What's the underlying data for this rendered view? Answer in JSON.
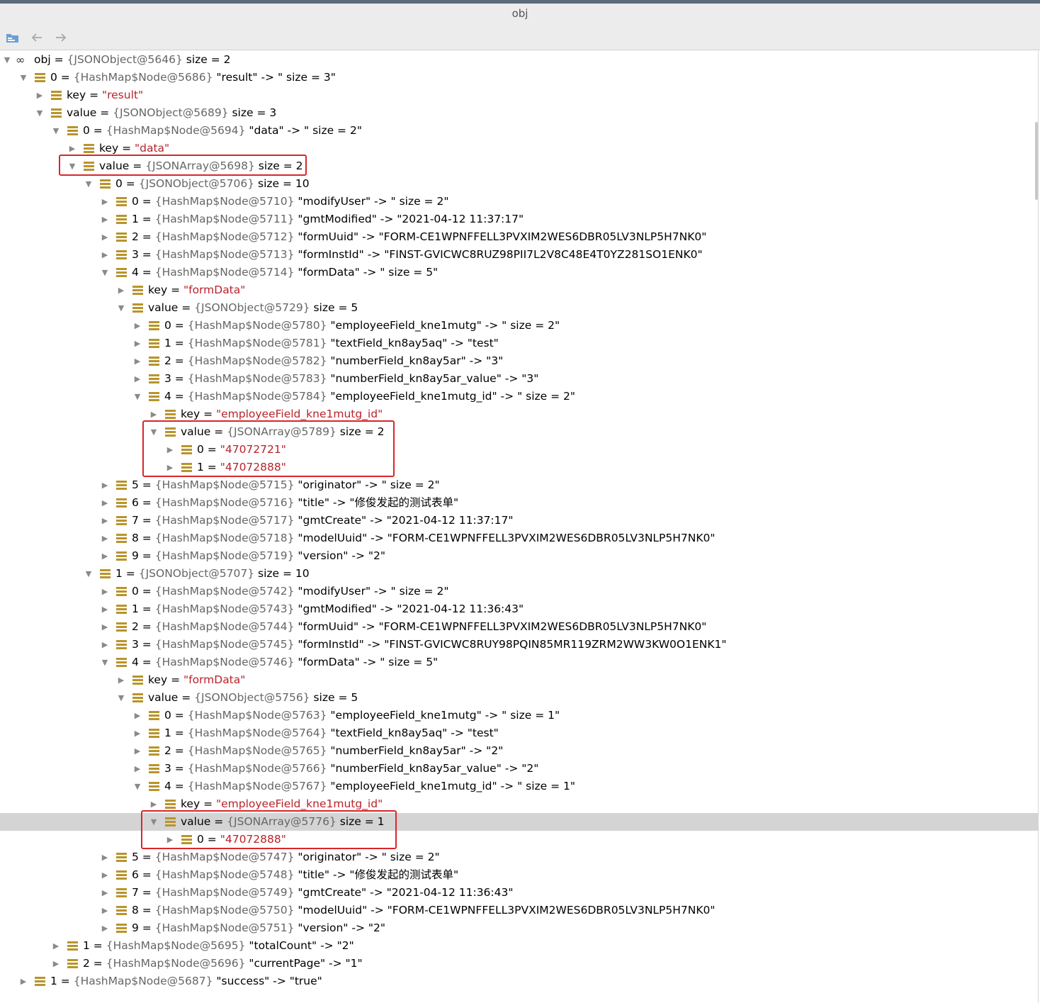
{
  "window": {
    "title": "obj"
  },
  "toolbar": {
    "icons": [
      "folder-icon",
      "back-arrow-icon",
      "forward-arrow-icon"
    ]
  },
  "tree": [
    {
      "depth": 0,
      "expanded": true,
      "icon": "infinity",
      "name": "obj",
      "ref": "{JSONObject@5646}",
      "desc": "size = 2"
    },
    {
      "depth": 1,
      "expanded": true,
      "name": "0",
      "ref": "{HashMap$Node@5686}",
      "desc": "\"result\" -> \" size = 3\""
    },
    {
      "depth": 2,
      "expanded": false,
      "name": "key",
      "str": "\"result\""
    },
    {
      "depth": 2,
      "expanded": true,
      "name": "value",
      "ref": "{JSONObject@5689}",
      "desc": "size = 3"
    },
    {
      "depth": 3,
      "expanded": true,
      "name": "0",
      "ref": "{HashMap$Node@5694}",
      "desc": "\"data\" -> \" size = 2\""
    },
    {
      "depth": 4,
      "expanded": false,
      "name": "key",
      "str": "\"data\""
    },
    {
      "depth": 4,
      "expanded": true,
      "name": "value",
      "ref": "{JSONArray@5698}",
      "desc": "size = 2"
    },
    {
      "depth": 5,
      "expanded": true,
      "name": "0",
      "ref": "{JSONObject@5706}",
      "desc": "size = 10"
    },
    {
      "depth": 6,
      "expanded": false,
      "name": "0",
      "ref": "{HashMap$Node@5710}",
      "desc": "\"modifyUser\" -> \" size = 2\""
    },
    {
      "depth": 6,
      "expanded": false,
      "name": "1",
      "ref": "{HashMap$Node@5711}",
      "desc": "\"gmtModified\" -> \"2021-04-12 11:37:17\""
    },
    {
      "depth": 6,
      "expanded": false,
      "name": "2",
      "ref": "{HashMap$Node@5712}",
      "desc": "\"formUuid\" -> \"FORM-CE1WPNFFELL3PVXIM2WES6DBR05LV3NLP5H7NK0\""
    },
    {
      "depth": 6,
      "expanded": false,
      "name": "3",
      "ref": "{HashMap$Node@5713}",
      "desc": "\"formInstId\" -> \"FINST-GVICWC8RUZ98PII7L2V8C48E4T0YZ281SO1ENK0\""
    },
    {
      "depth": 6,
      "expanded": true,
      "name": "4",
      "ref": "{HashMap$Node@5714}",
      "desc": "\"formData\" -> \" size = 5\""
    },
    {
      "depth": 7,
      "expanded": false,
      "name": "key",
      "str": "\"formData\""
    },
    {
      "depth": 7,
      "expanded": true,
      "name": "value",
      "ref": "{JSONObject@5729}",
      "desc": "size = 5"
    },
    {
      "depth": 8,
      "expanded": false,
      "name": "0",
      "ref": "{HashMap$Node@5780}",
      "desc": "\"employeeField_kne1mutg\" -> \" size = 2\""
    },
    {
      "depth": 8,
      "expanded": false,
      "name": "1",
      "ref": "{HashMap$Node@5781}",
      "desc": "\"textField_kn8ay5aq\" -> \"test\""
    },
    {
      "depth": 8,
      "expanded": false,
      "name": "2",
      "ref": "{HashMap$Node@5782}",
      "desc": "\"numberField_kn8ay5ar\" -> \"3\""
    },
    {
      "depth": 8,
      "expanded": false,
      "name": "3",
      "ref": "{HashMap$Node@5783}",
      "desc": "\"numberField_kn8ay5ar_value\" -> \"3\""
    },
    {
      "depth": 8,
      "expanded": true,
      "name": "4",
      "ref": "{HashMap$Node@5784}",
      "desc": "\"employeeField_kne1mutg_id\" -> \" size = 2\""
    },
    {
      "depth": 9,
      "expanded": false,
      "name": "key",
      "str": "\"employeeField_kne1mutg_id\""
    },
    {
      "depth": 9,
      "expanded": true,
      "name": "value",
      "ref": "{JSONArray@5789}",
      "desc": "size = 2"
    },
    {
      "depth": 10,
      "expanded": false,
      "name": "0",
      "str": "\"47072721\""
    },
    {
      "depth": 10,
      "expanded": false,
      "name": "1",
      "str": "\"47072888\""
    },
    {
      "depth": 6,
      "expanded": false,
      "name": "5",
      "ref": "{HashMap$Node@5715}",
      "desc": "\"originator\" -> \" size = 2\""
    },
    {
      "depth": 6,
      "expanded": false,
      "name": "6",
      "ref": "{HashMap$Node@5716}",
      "desc": "\"title\" -> \"修俊发起的测试表单\""
    },
    {
      "depth": 6,
      "expanded": false,
      "name": "7",
      "ref": "{HashMap$Node@5717}",
      "desc": "\"gmtCreate\" -> \"2021-04-12 11:37:17\""
    },
    {
      "depth": 6,
      "expanded": false,
      "name": "8",
      "ref": "{HashMap$Node@5718}",
      "desc": "\"modelUuid\" -> \"FORM-CE1WPNFFELL3PVXIM2WES6DBR05LV3NLP5H7NK0\""
    },
    {
      "depth": 6,
      "expanded": false,
      "name": "9",
      "ref": "{HashMap$Node@5719}",
      "desc": "\"version\" -> \"2\""
    },
    {
      "depth": 5,
      "expanded": true,
      "name": "1",
      "ref": "{JSONObject@5707}",
      "desc": "size = 10"
    },
    {
      "depth": 6,
      "expanded": false,
      "name": "0",
      "ref": "{HashMap$Node@5742}",
      "desc": "\"modifyUser\" -> \" size = 2\""
    },
    {
      "depth": 6,
      "expanded": false,
      "name": "1",
      "ref": "{HashMap$Node@5743}",
      "desc": "\"gmtModified\" -> \"2021-04-12 11:36:43\""
    },
    {
      "depth": 6,
      "expanded": false,
      "name": "2",
      "ref": "{HashMap$Node@5744}",
      "desc": "\"formUuid\" -> \"FORM-CE1WPNFFELL3PVXIM2WES6DBR05LV3NLP5H7NK0\""
    },
    {
      "depth": 6,
      "expanded": false,
      "name": "3",
      "ref": "{HashMap$Node@5745}",
      "desc": "\"formInstId\" -> \"FINST-GVICWC8RUY98PQIN85MR119ZRM2WW3KW0O1ENK1\""
    },
    {
      "depth": 6,
      "expanded": true,
      "name": "4",
      "ref": "{HashMap$Node@5746}",
      "desc": "\"formData\" -> \" size = 5\""
    },
    {
      "depth": 7,
      "expanded": false,
      "name": "key",
      "str": "\"formData\""
    },
    {
      "depth": 7,
      "expanded": true,
      "name": "value",
      "ref": "{JSONObject@5756}",
      "desc": "size = 5"
    },
    {
      "depth": 8,
      "expanded": false,
      "name": "0",
      "ref": "{HashMap$Node@5763}",
      "desc": "\"employeeField_kne1mutg\" -> \" size = 1\""
    },
    {
      "depth": 8,
      "expanded": false,
      "name": "1",
      "ref": "{HashMap$Node@5764}",
      "desc": "\"textField_kn8ay5aq\" -> \"test\""
    },
    {
      "depth": 8,
      "expanded": false,
      "name": "2",
      "ref": "{HashMap$Node@5765}",
      "desc": "\"numberField_kn8ay5ar\" -> \"2\""
    },
    {
      "depth": 8,
      "expanded": false,
      "name": "3",
      "ref": "{HashMap$Node@5766}",
      "desc": "\"numberField_kn8ay5ar_value\" -> \"2\""
    },
    {
      "depth": 8,
      "expanded": true,
      "name": "4",
      "ref": "{HashMap$Node@5767}",
      "desc": "\"employeeField_kne1mutg_id\" -> \" size = 1\""
    },
    {
      "depth": 9,
      "expanded": false,
      "name": "key",
      "str": "\"employeeField_kne1mutg_id\""
    },
    {
      "depth": 9,
      "expanded": true,
      "selected": true,
      "name": "value",
      "ref": "{JSONArray@5776}",
      "desc": "size = 1"
    },
    {
      "depth": 10,
      "expanded": false,
      "name": "0",
      "str": "\"47072888\""
    },
    {
      "depth": 6,
      "expanded": false,
      "name": "5",
      "ref": "{HashMap$Node@5747}",
      "desc": "\"originator\" -> \" size = 2\""
    },
    {
      "depth": 6,
      "expanded": false,
      "name": "6",
      "ref": "{HashMap$Node@5748}",
      "desc": "\"title\" -> \"修俊发起的测试表单\""
    },
    {
      "depth": 6,
      "expanded": false,
      "name": "7",
      "ref": "{HashMap$Node@5749}",
      "desc": "\"gmtCreate\" -> \"2021-04-12 11:36:43\""
    },
    {
      "depth": 6,
      "expanded": false,
      "name": "8",
      "ref": "{HashMap$Node@5750}",
      "desc": "\"modelUuid\" -> \"FORM-CE1WPNFFELL3PVXIM2WES6DBR05LV3NLP5H7NK0\""
    },
    {
      "depth": 6,
      "expanded": false,
      "name": "9",
      "ref": "{HashMap$Node@5751}",
      "desc": "\"version\" -> \"2\""
    },
    {
      "depth": 3,
      "expanded": false,
      "name": "1",
      "ref": "{HashMap$Node@5695}",
      "desc": "\"totalCount\" -> \"2\""
    },
    {
      "depth": 3,
      "expanded": false,
      "name": "2",
      "ref": "{HashMap$Node@5696}",
      "desc": "\"currentPage\" -> \"1\""
    },
    {
      "depth": 1,
      "expanded": false,
      "name": "1",
      "ref": "{HashMap$Node@5687}",
      "desc": "\"success\" -> \"true\""
    }
  ],
  "colors": {
    "string": "#b8232a",
    "ref": "#666666",
    "highlight": "#d9262a",
    "selection": "#d4d4d4"
  }
}
